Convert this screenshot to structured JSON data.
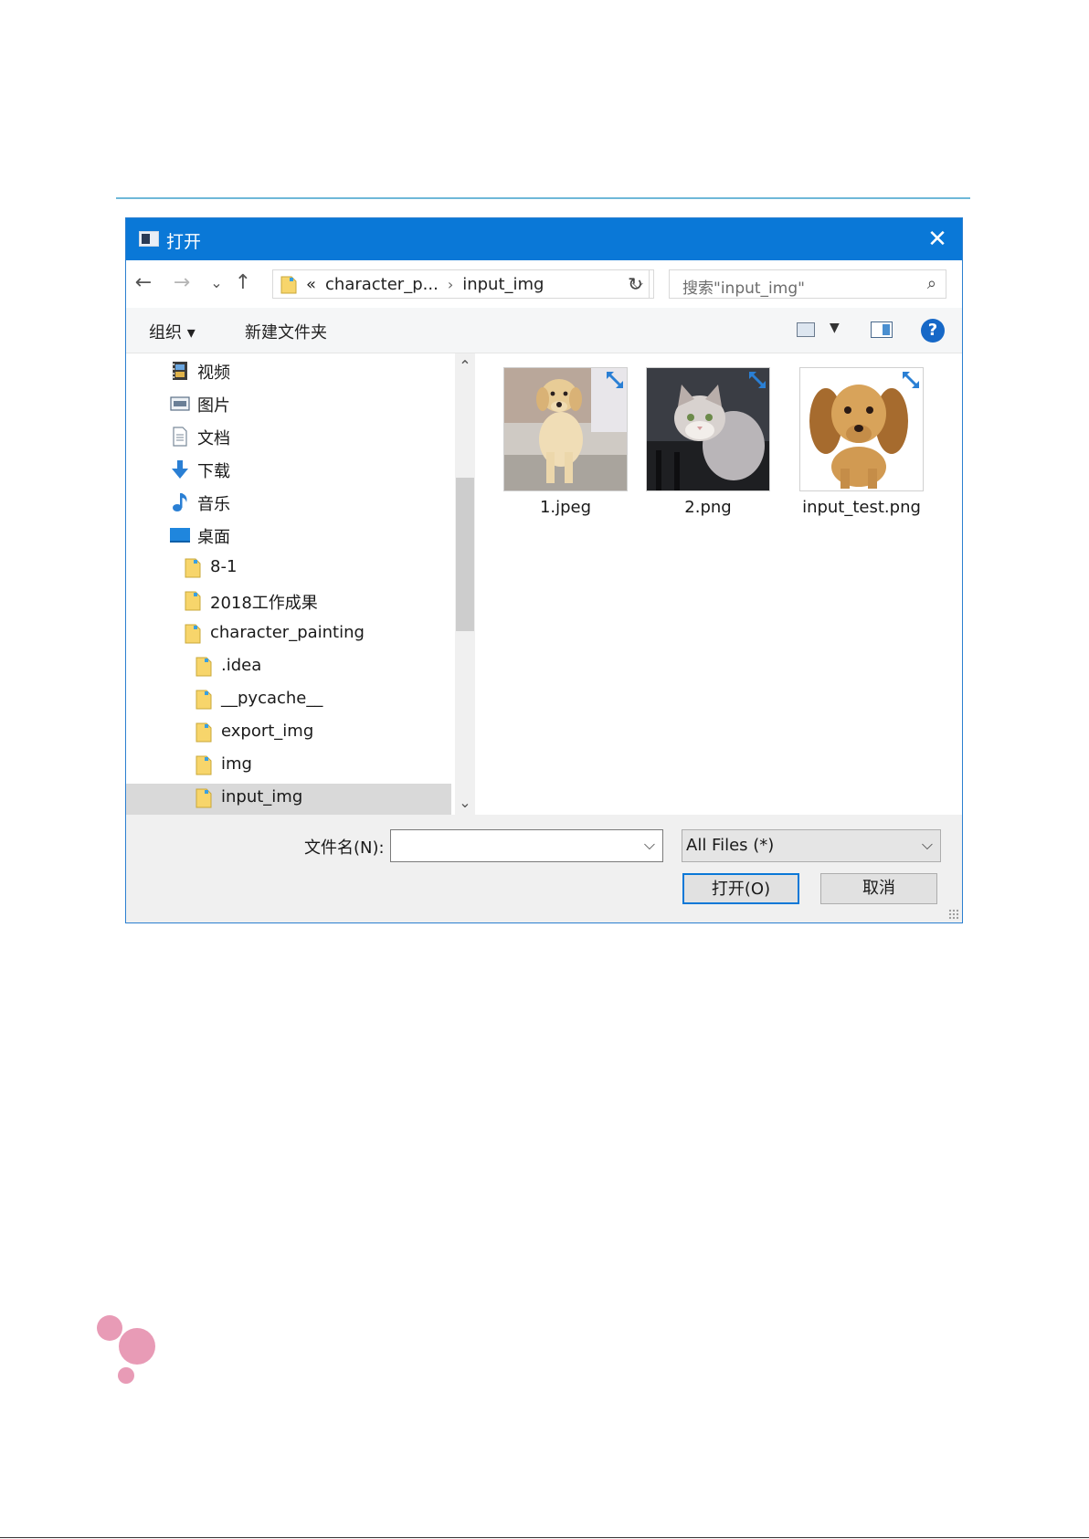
{
  "dialog": {
    "title": "打开",
    "close_glyph": "✕"
  },
  "navbar": {
    "back_glyph": "←",
    "forward_glyph": "→",
    "recent_glyph": "⌄",
    "up_glyph": "↑",
    "breadcrumb_prefix": "«",
    "breadcrumbs": [
      "character_p...",
      "input_img"
    ],
    "breadcrumb_sep": "›",
    "dropdown_glyph": "⌵",
    "refresh_glyph": "↻",
    "search_placeholder": "搜索\"input_img\"",
    "search_glyph": "⌕"
  },
  "cmdbar": {
    "organize_label": "组织 ▾",
    "new_folder_label": "新建文件夹",
    "view_dd_glyph": "▼",
    "help_glyph": "?"
  },
  "navpane": {
    "items": [
      {
        "label": "视频",
        "icon": "video-icon"
      },
      {
        "label": "图片",
        "icon": "pictures-icon"
      },
      {
        "label": "文档",
        "icon": "documents-icon"
      },
      {
        "label": "下载",
        "icon": "download-icon"
      },
      {
        "label": "音乐",
        "icon": "music-icon"
      },
      {
        "label": "桌面",
        "icon": "desktop-icon"
      },
      {
        "label": "8-1",
        "icon": "folder-icon"
      },
      {
        "label": "2018工作成果",
        "icon": "folder-icon"
      },
      {
        "label": "character_painting",
        "icon": "folder-icon"
      },
      {
        "label": ".idea",
        "icon": "folder-icon"
      },
      {
        "label": "__pycache__",
        "icon": "folder-icon"
      },
      {
        "label": "export_img",
        "icon": "folder-icon"
      },
      {
        "label": "img",
        "icon": "folder-icon"
      },
      {
        "label": "input_img",
        "icon": "folder-icon",
        "selected": true
      }
    ],
    "scroll_up_glyph": "⌃",
    "scroll_down_glyph": "⌄"
  },
  "files": [
    {
      "name": "1.jpeg",
      "thumb": "golden-retriever-puppy"
    },
    {
      "name": "2.png",
      "thumb": "grey-white-kitten"
    },
    {
      "name": "input_test.png",
      "thumb": "dachshund-puppy"
    }
  ],
  "footer": {
    "filename_label": "文件名(N):",
    "filename_value": "",
    "filter_value": "All Files  (*)",
    "dropdown_glyph": "⌵",
    "open_label": "打开(O)",
    "cancel_label": "取消"
  },
  "colors": {
    "titlebar": "#0a78d7",
    "folder": "#f7d56b",
    "selection": "#d9d9d9",
    "bubbles": "#e89bb6"
  }
}
